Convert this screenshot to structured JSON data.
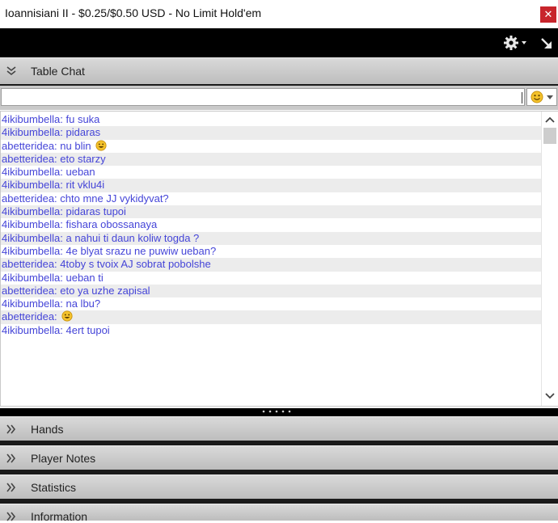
{
  "window": {
    "title": "Ioannisiani II - $0.25/$0.50 USD - No Limit Hold'em",
    "close_glyph": "✕"
  },
  "toolbar": {
    "icons": [
      "gear-icon",
      "chevron-down-icon",
      "popout-arrow-icon"
    ]
  },
  "table_chat": {
    "label": "Table Chat",
    "input_value": "",
    "messages": [
      {
        "text": "4ikibumbella: fu suka",
        "emoji": false
      },
      {
        "text": "4ikibumbella: pidaras",
        "emoji": false
      },
      {
        "text": "abetteridea: nu blin",
        "emoji": true
      },
      {
        "text": "abetteridea: eto starzy",
        "emoji": false
      },
      {
        "text": "4ikibumbella: ueban",
        "emoji": false
      },
      {
        "text": "4ikibumbella: rit vklu4i",
        "emoji": false
      },
      {
        "text": "abetteridea: chto mne JJ vykidyvat?",
        "emoji": false
      },
      {
        "text": "4ikibumbella: pidaras tupoi",
        "emoji": false
      },
      {
        "text": "4ikibumbella: fishara obossanaya",
        "emoji": false
      },
      {
        "text": "4ikibumbella: a nahui ti daun koliw togda ?",
        "emoji": false
      },
      {
        "text": "4ikibumbella: 4e blyat srazu ne puwiw ueban?",
        "emoji": false
      },
      {
        "text": "abetteridea: 4toby s tvoix AJ sobrat pobolshe",
        "emoji": false
      },
      {
        "text": "4ikibumbella: ueban ti",
        "emoji": false
      },
      {
        "text": "abetteridea: eto ya uzhe zapisal",
        "emoji": false
      },
      {
        "text": "4ikibumbella: na lbu?",
        "emoji": false
      },
      {
        "text": "abetteridea:",
        "emoji": true
      },
      {
        "text": "4ikibumbella: 4ert tupoi",
        "emoji": false
      }
    ]
  },
  "sections": [
    {
      "id": "hands",
      "label": "Hands"
    },
    {
      "id": "player-notes",
      "label": "Player Notes"
    },
    {
      "id": "statistics",
      "label": "Statistics"
    },
    {
      "id": "information",
      "label": "Information"
    }
  ],
  "colors": {
    "message_text": "#4545d8",
    "close_button": "#c8252c",
    "toolbar_bg": "#000000",
    "header_bg": "#d0d0d0"
  }
}
